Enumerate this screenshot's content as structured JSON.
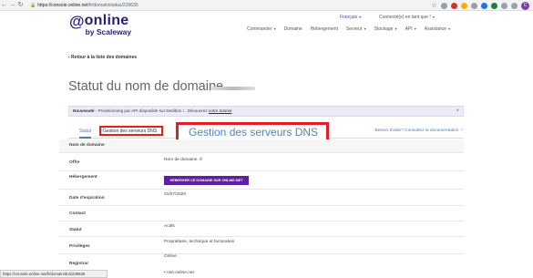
{
  "browser": {
    "url_host": "https://console.online.net",
    "url_path": "/fr/domain/status/239635",
    "profile_initial": "C"
  },
  "header": {
    "logo_line1": "online",
    "logo_line2": "by Scaleway",
    "language": "Français",
    "account": "Connecté(e) en tant que !",
    "nav": [
      "Commander",
      "Domaine",
      "Hébergement",
      "Serveur",
      "Stockage",
      "API",
      "Assistance"
    ]
  },
  "back_link": "‹ Retour à la liste des domaines",
  "page_title": "Statut du nom de domaine",
  "notice": {
    "bold": "Nouveauté",
    "text": " - Provisionning par API disponible sur Dedibox ! . Découvrez ",
    "link": "notre tutoriel",
    "close": "×"
  },
  "tabs": {
    "statut": "Statut",
    "dns": "Gestion des serveurs DNS",
    "help": "Besoin d'aide? Consultez la documentation ☞"
  },
  "callout": "Gestion des serveurs DNS",
  "table": {
    "header": "Nom de domaine",
    "offre_label": "Offre",
    "offre_value": "Nom de domaine .fr",
    "hebergement_label": "Hébergement",
    "hebergement_button": "HÉBERGER CE DOMAINE SUR ONLINE.NET",
    "expiration_label": "Date d'expiration",
    "expiration_value": "21/07/2020",
    "contact_label": "Contact",
    "statut_label": "Statut",
    "statut_value": "Actifs",
    "privileges_label": "Privilèges",
    "privileges_value": "Propriétaire, technique et facturation",
    "registrar_label": "Registrar",
    "registrar_value": "Online",
    "dns_value": "ns0.online.net"
  },
  "statusbar": "https://console.online.net/fr/domain/dns/239635"
}
